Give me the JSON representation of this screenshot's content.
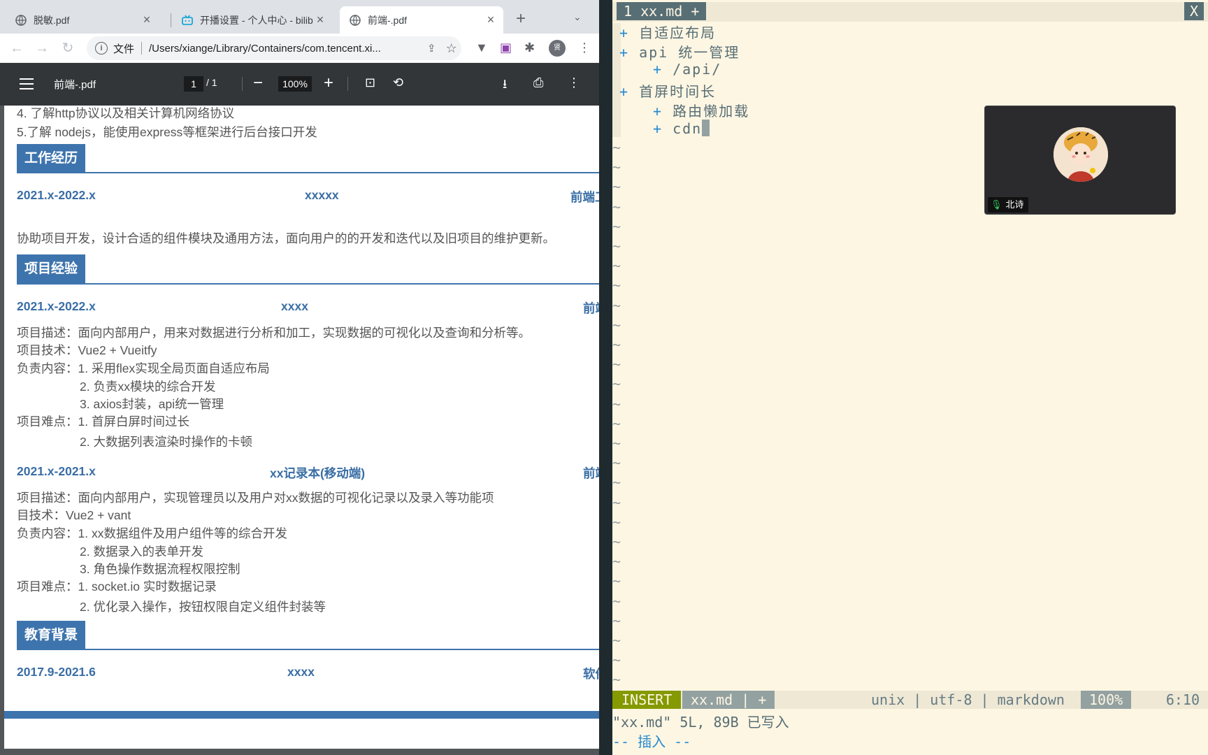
{
  "browser": {
    "tabs": [
      {
        "label": "脱敏.pdf",
        "icon": "globe-icon",
        "active": false
      },
      {
        "label": "开播设置 - 个人中心 - bilibili",
        "icon": "bilibili-icon",
        "active": false
      },
      {
        "label": "前端-.pdf",
        "icon": "globe-icon",
        "active": true
      }
    ],
    "new_tab": "+",
    "tab_search": "⌄",
    "omnibox": {
      "scheme_label": "文件",
      "url": "/Users/xiange/Library/Containers/com.tencent.xi..."
    },
    "profile_initial": "贤"
  },
  "pdf_viewer": {
    "title": "前端-.pdf",
    "page_current": "1",
    "page_total": "/  1",
    "zoom": "100%"
  },
  "resume": {
    "skills_tail": [
      "4. 了解http协议以及相关计算机网络协议",
      "5.了解 nodejs，能使用express等框架进行后台接口开发"
    ],
    "work": {
      "heading": "工作经历",
      "date": "2021.x-2022.x",
      "company": "xxxxx",
      "role": "前端工",
      "desc": "协助项目开发，设计合适的组件模块及通用方法，面向用户的的开发和迭代以及旧项目的维护更新。"
    },
    "projects": {
      "heading": "项目经验",
      "items": [
        {
          "date": "2021.x-2022.x",
          "name": "xxxx",
          "role": "前端",
          "lines": [
            "项目描述：面向内部用户，用来对数据进行分析和加工，实现数据的可视化以及查询和分析等。",
            "项目技术：Vue2 + Vueitfy",
            "负责内容：1. 采用flex实现全局页面自适应布局",
            "2. 负责xx模块的综合开发",
            "3. axios封装，api统一管理",
            "项目难点：1. 首屏白屏时间过长",
            "2. 大数据列表渲染时操作的卡顿"
          ]
        },
        {
          "date": "2021.x-2021.x",
          "name": "xx记录本(移动端)",
          "role": "前端",
          "lines": [
            "项目描述：面向内部用户，实现管理员以及用户对xx数据的可视化记录以及录入等功能项",
            "目技术：Vue2 + vant",
            "负责内容：1. xx数据组件及用户组件等的综合开发",
            "2. 数据录入的表单开发",
            "3. 角色操作数据流程权限控制",
            "项目难点：1. socket.io 实时数据记录",
            "2. 优化录入操作，按钮权限自定义组件封装等"
          ]
        }
      ]
    },
    "education": {
      "heading": "教育背景",
      "date": "2017.9-2021.6",
      "school": "xxxx",
      "major": "软件"
    }
  },
  "vim": {
    "tab_label": "1 xx.md +",
    "close_label": "X",
    "lines": [
      {
        "indent": "",
        "text": "自适应布局"
      },
      {
        "indent": "",
        "text": "api 统一管理"
      },
      {
        "indent": "    ",
        "text": "/api/"
      },
      {
        "indent": "",
        "text": "首屏时间长"
      },
      {
        "indent": "    ",
        "text": "路由懒加载"
      },
      {
        "indent": "    ",
        "text": "cdn"
      }
    ],
    "bullet": "+",
    "tilde": "~",
    "status": {
      "mode": "INSERT",
      "file": "xx.md | +",
      "info": "unix | utf-8 | markdown",
      "percent": "100%",
      "position": "6:10"
    },
    "message": "\"xx.md\" 5L, 89B 已写入",
    "mode_line": "-- 插入 --"
  },
  "video_call": {
    "participant_name": "北诗"
  },
  "colors": {
    "accent_blue": "#3e74ad",
    "vim_bg": "#fdf6e3",
    "vim_insert": "#859900",
    "pdf_toolbar": "#323639"
  }
}
